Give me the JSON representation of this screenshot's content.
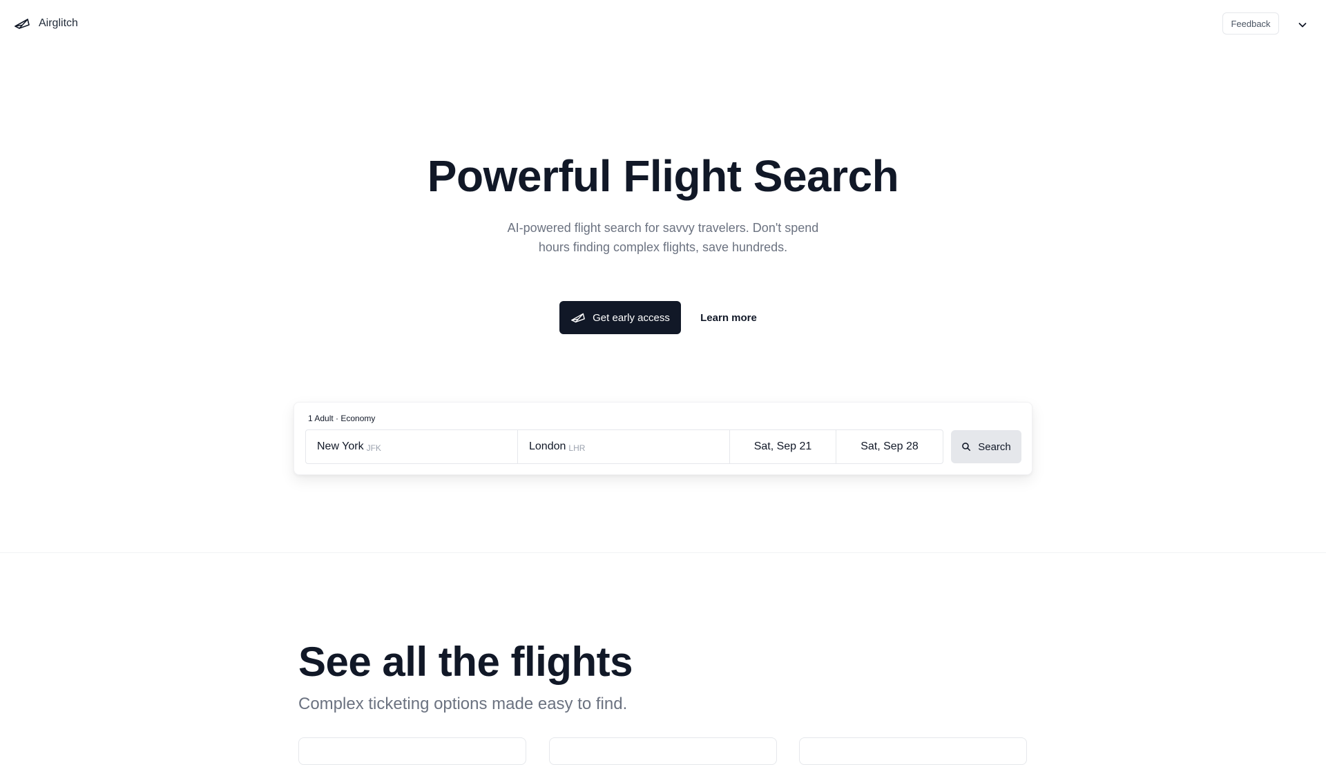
{
  "header": {
    "brand_name": "Airglitch",
    "feedback_label": "Feedback"
  },
  "hero": {
    "title": "Powerful Flight Search",
    "subtitle": "AI-powered flight search for savvy travelers. Don't spend hours finding complex flights, save hundreds.",
    "primary_cta": "Get early access",
    "secondary_cta": "Learn more"
  },
  "search": {
    "travelers": "1 Adult · Economy",
    "origin_city": "New York",
    "origin_code": "JFK",
    "destination_city": "London",
    "destination_code": "LHR",
    "depart_date": "Sat, Sep 21",
    "return_date": "Sat, Sep 28",
    "search_label": "Search"
  },
  "section": {
    "title": "See all the flights",
    "subtitle": "Complex ticketing options made easy to find."
  },
  "colors": {
    "primary": "#111827",
    "muted_text": "#6b7280",
    "border": "#e5e7eb",
    "search_button_bg": "#e5e7eb"
  },
  "icons": {
    "brand": "paper-plane-icon",
    "menu": "chevron-down-icon",
    "cta": "paper-plane-icon",
    "search": "search-icon"
  }
}
